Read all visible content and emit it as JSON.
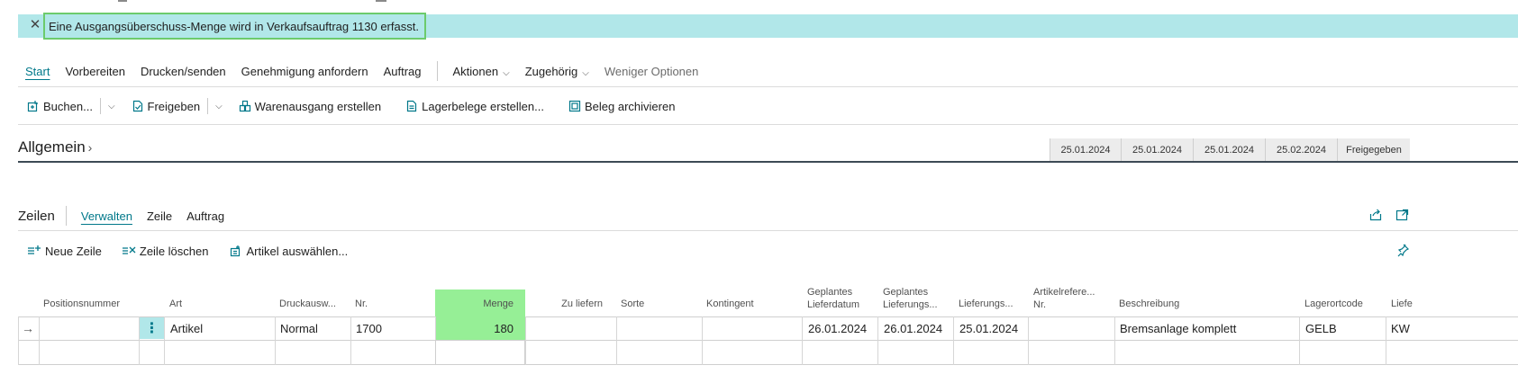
{
  "notification": {
    "text": "Eine Ausgangsüberschuss-Menge wird in Verkaufsauftrag 1130 erfasst."
  },
  "action_bar": {
    "items": [
      {
        "label": "Start"
      },
      {
        "label": "Vorbereiten"
      },
      {
        "label": "Drucken/senden"
      },
      {
        "label": "Genehmigung anfordern"
      },
      {
        "label": "Auftrag"
      },
      {
        "label": "Aktionen"
      },
      {
        "label": "Zugehörig"
      },
      {
        "label": "Weniger Optionen"
      }
    ]
  },
  "toolbar": {
    "post": "Buchen...",
    "release": "Freigeben",
    "create_shipment": "Warenausgang erstellen",
    "create_whse_docs": "Lagerbelege erstellen...",
    "archive": "Beleg archivieren"
  },
  "general": {
    "title": "Allgemein",
    "fastboxes": [
      "25.01.2024",
      "25.01.2024",
      "25.01.2024",
      "25.02.2024",
      "Freigegeben"
    ]
  },
  "lines": {
    "title": "Zeilen",
    "tabs": [
      {
        "label": "Verwalten"
      },
      {
        "label": "Zeile"
      },
      {
        "label": "Auftrag"
      }
    ],
    "toolbar": {
      "new_line": "Neue Zeile",
      "delete_line": "Zeile löschen",
      "select_items": "Artikel auswählen..."
    }
  },
  "grid": {
    "columns": {
      "position": "Positionsnummer",
      "type": "Art",
      "print_option": "Druckausw...",
      "no": "Nr.",
      "quantity": "Menge",
      "to_deliver": "Zu liefern",
      "variety": "Sorte",
      "quota": "Kontingent",
      "planned_delivery_1": "Geplantes",
      "planned_delivery_2": "Lieferdatum",
      "planned_shipment_1": "Geplantes",
      "planned_shipment_2": "Lieferungs...",
      "delivery": "Lieferungs...",
      "item_ref_1": "Artikelrefere...",
      "item_ref_2": "Nr.",
      "description": "Beschreibung",
      "location": "Lagerortcode",
      "extra": "Liefe"
    },
    "row": {
      "type": "Artikel",
      "print_option": "Normal",
      "no": "1700",
      "quantity": "180",
      "planned_delivery": "26.01.2024",
      "planned_shipment": "26.01.2024",
      "delivery": "25.01.2024",
      "description": "Bremsanlage komplett",
      "location": "GELB",
      "extra": "KW"
    }
  },
  "colors": {
    "accent": "#00788a",
    "notification_bg": "#b1e7e9",
    "highlight_green": "#96ef96",
    "notification_border": "#6ccb6c"
  }
}
